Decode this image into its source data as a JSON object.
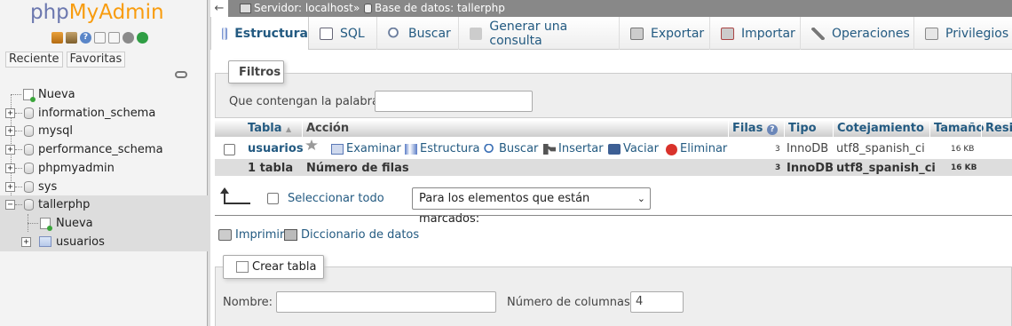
{
  "logo": {
    "part1": "php",
    "part2": "MyAdmin"
  },
  "nav_icons": [
    "home-icon",
    "exit-icon",
    "help-icon",
    "docs-icon",
    "page-icon",
    "settings-icon",
    "reload-icon"
  ],
  "nav_tabs": {
    "recent": "Reciente",
    "favorites": "Favoritas"
  },
  "tree": [
    {
      "label": "Nueva",
      "type": "new"
    },
    {
      "label": "information_schema",
      "type": "db"
    },
    {
      "label": "mysql",
      "type": "db"
    },
    {
      "label": "performance_schema",
      "type": "db"
    },
    {
      "label": "phpmyadmin",
      "type": "db"
    },
    {
      "label": "sys",
      "type": "db"
    },
    {
      "label": "tallerphp",
      "type": "db",
      "selected": true
    },
    {
      "label": "Nueva",
      "type": "new-child"
    },
    {
      "label": "usuarios",
      "type": "table-child"
    }
  ],
  "breadcrumb": {
    "server": "Servidor: localhost",
    "sep": "»",
    "database": "Base de datos: tallerphp",
    "back": "←"
  },
  "tabs": [
    "Estructura",
    "SQL",
    "Buscar",
    "Generar una consulta",
    "Exportar",
    "Importar",
    "Operaciones",
    "Privilegios"
  ],
  "filter": {
    "legend": "Filtros",
    "label": "Que contengan la palabra:",
    "value": ""
  },
  "table": {
    "headers": {
      "table": "Tabla",
      "sort_arrow": "▲",
      "action": "Acción",
      "rows": "Filas",
      "rows_help": "?",
      "type": "Tipo",
      "collation": "Cotejamiento",
      "size": "Tamaño",
      "overhead": "Resid"
    },
    "rows": [
      {
        "name": "usuarios",
        "actions": [
          "Examinar",
          "Estructura",
          "Buscar",
          "Insertar",
          "Vaciar",
          "Eliminar"
        ],
        "rows": "3",
        "type": "InnoDB",
        "collation": "utf8_spanish_ci",
        "size": "16 KB"
      }
    ],
    "footer": {
      "count": "1 tabla",
      "label": "Número de filas",
      "rows": "3",
      "type": "InnoDB",
      "collation": "utf8_spanish_ci",
      "size": "16 KB"
    }
  },
  "bulk": {
    "select_all": "Seleccionar todo",
    "with_selected": "Para los elementos que están marcados:"
  },
  "links": {
    "print": "Imprimir",
    "dictionary": "Diccionario de datos"
  },
  "create": {
    "legend": "Crear tabla",
    "name_label": "Nombre:",
    "name_value": "",
    "columns_label": "Número de columnas:",
    "columns_value": "4"
  }
}
